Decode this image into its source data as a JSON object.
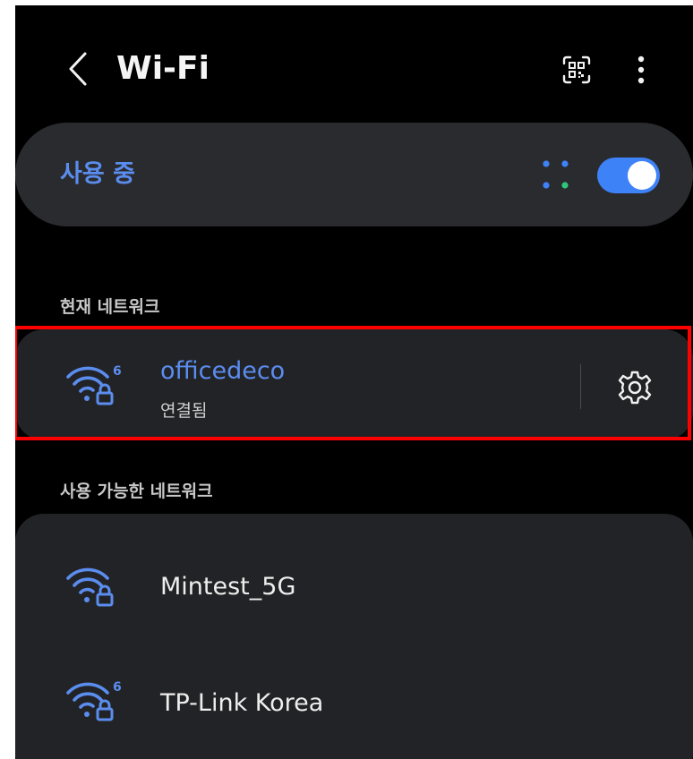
{
  "header": {
    "title": "Wi-Fi",
    "back_icon": "chevron-left-icon",
    "qr_icon": "qr-code-scan-icon",
    "more_icon": "more-vertical-icon"
  },
  "master": {
    "label": "사용 중",
    "toggle_on": true,
    "accent": "#3e82f7",
    "scan_icon": "scanning-dots-icon"
  },
  "current_network": {
    "section_label": "현재 네트워크",
    "name": "officedeco",
    "status": "연결됨",
    "icon": "wifi-6-locked-icon",
    "settings_icon": "gear-icon"
  },
  "available_networks": {
    "section_label": "사용 가능한 네트워크",
    "items": [
      {
        "name": "Mintest_5G",
        "icon": "wifi-locked-icon"
      },
      {
        "name": "TP-Link Korea",
        "icon": "wifi-6-locked-icon"
      }
    ]
  },
  "colors": {
    "background": "#000000",
    "card": "#222326",
    "accent_blue": "#5b8def",
    "highlight": "#ff0000"
  }
}
